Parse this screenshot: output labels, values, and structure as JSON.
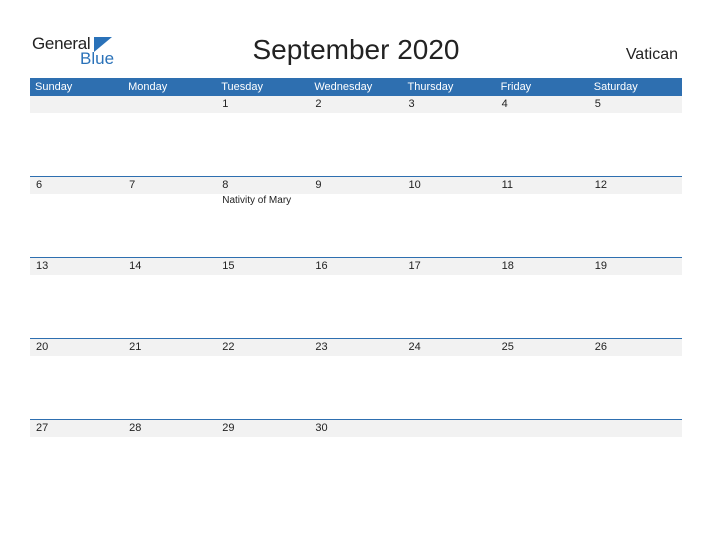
{
  "logo": {
    "line1": "General",
    "line2": "Blue"
  },
  "title": "September 2020",
  "country": "Vatican",
  "colors": {
    "accent": "#2e6fb0",
    "strip": "#f2f2f2"
  },
  "weekdays": [
    "Sunday",
    "Monday",
    "Tuesday",
    "Wednesday",
    "Thursday",
    "Friday",
    "Saturday"
  ],
  "weeks": [
    {
      "days": [
        "",
        "",
        "1",
        "2",
        "3",
        "4",
        "5"
      ],
      "events": [
        "",
        "",
        "",
        "",
        "",
        "",
        ""
      ]
    },
    {
      "days": [
        "6",
        "7",
        "8",
        "9",
        "10",
        "11",
        "12"
      ],
      "events": [
        "",
        "",
        "Nativity of Mary",
        "",
        "",
        "",
        ""
      ]
    },
    {
      "days": [
        "13",
        "14",
        "15",
        "16",
        "17",
        "18",
        "19"
      ],
      "events": [
        "",
        "",
        "",
        "",
        "",
        "",
        ""
      ]
    },
    {
      "days": [
        "20",
        "21",
        "22",
        "23",
        "24",
        "25",
        "26"
      ],
      "events": [
        "",
        "",
        "",
        "",
        "",
        "",
        ""
      ]
    },
    {
      "days": [
        "27",
        "28",
        "29",
        "30",
        "",
        "",
        ""
      ],
      "events": [
        "",
        "",
        "",
        "",
        "",
        "",
        ""
      ]
    }
  ]
}
